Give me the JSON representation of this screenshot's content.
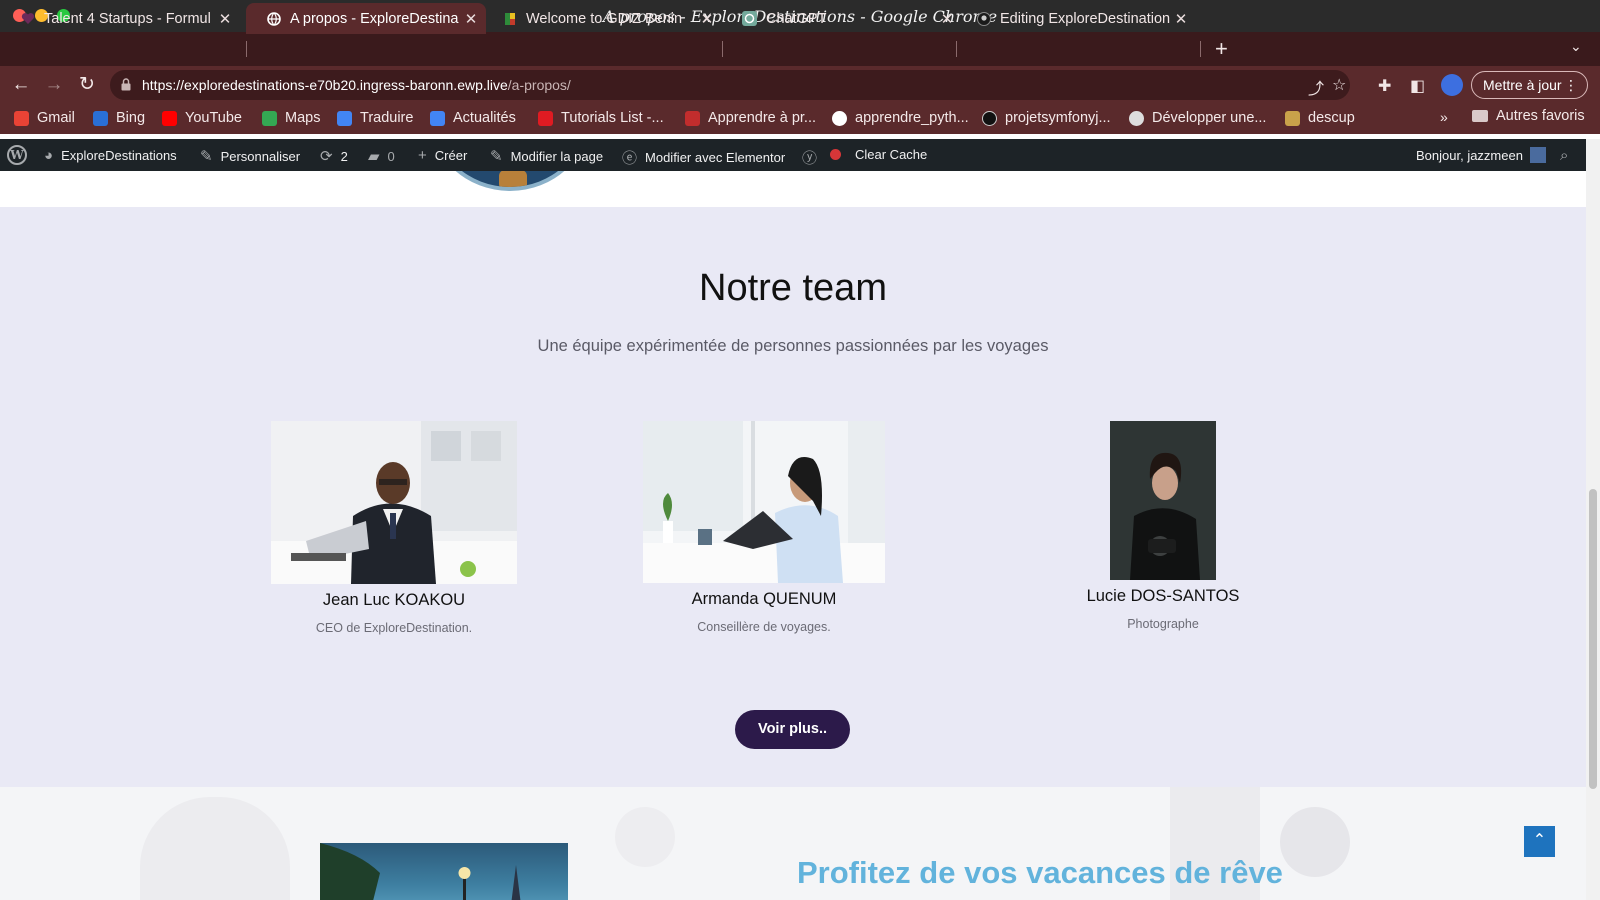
{
  "window": {
    "title": "A propos - ExploreDestinations - Google Chrome"
  },
  "tabs": [
    {
      "label": "Talent 4 Startups - Formul",
      "icon": "heart-icon",
      "color": "#6b2a5a"
    },
    {
      "label": "A propos - ExploreDestina",
      "icon": "globe-icon",
      "color": "#ffffff",
      "active": true
    },
    {
      "label": "Welcome to GDIZ Benin",
      "icon": "gdiz-icon",
      "color": "#c23b2b"
    },
    {
      "label": "ChatGPT",
      "icon": "chatgpt-icon",
      "color": "#74aa9c"
    },
    {
      "label": "Editing ExploreDestination",
      "icon": "github-icon",
      "color": "#cccccc"
    }
  ],
  "toolbar": {
    "url_host": "https://exploredestinations-e70b20.ingress-baronn.ewp.live",
    "url_path": "/a-propos/",
    "update_label": "Mettre à jour"
  },
  "bookmarks": {
    "items": [
      {
        "label": "Gmail",
        "color": "#ea4335"
      },
      {
        "label": "Bing",
        "color": "#2a6fd6"
      },
      {
        "label": "YouTube",
        "color": "#ff0000"
      },
      {
        "label": "Maps",
        "color": "#34a853"
      },
      {
        "label": "Traduire",
        "color": "#4285f4"
      },
      {
        "label": "Actualités",
        "color": "#4285f4"
      },
      {
        "label": "Tutorials List -...",
        "color": "#e01b22"
      },
      {
        "label": "Apprendre à pr...",
        "color": "#c22d2d"
      },
      {
        "label": "apprendre_pyth...",
        "color": "#ffffff"
      },
      {
        "label": "projetsymfonyj...",
        "color": "#111111"
      },
      {
        "label": "Développer une...",
        "color": "#dddddd"
      },
      {
        "label": "descup",
        "color": "#c9a24a"
      }
    ],
    "other_label": "Autres favoris"
  },
  "wpbar": {
    "site": "ExploreDestinations",
    "customize": "Personnaliser",
    "updates": "2",
    "comments": "0",
    "create": "Créer",
    "edit_page": "Modifier la page",
    "elementor": "Modifier avec Elementor",
    "clear_cache": "Clear Cache",
    "greeting": "Bonjour, jazzmeen"
  },
  "team": {
    "title": "Notre team",
    "subtitle": "Une équipe expérimentée de personnes passionnées par les voyages",
    "members": [
      {
        "name": "Jean Luc KOAKOU",
        "role": "CEO de ExploreDestination."
      },
      {
        "name": "Armanda QUENUM",
        "role": "Conseillère de voyages."
      },
      {
        "name": "Lucie DOS-SANTOS",
        "role": "Photographe"
      }
    ],
    "button": "Voir plus.."
  },
  "promo": {
    "title": "Profitez de vos vacances de rêve"
  },
  "colors": {
    "chrome_frame": "#3a1a1c",
    "chrome_toolbar": "#5a2a2c",
    "wp_bar": "#1d2327",
    "team_bg": "#e9e9f5",
    "button": "#2c1a4a",
    "promo_title": "#62b3dc"
  }
}
